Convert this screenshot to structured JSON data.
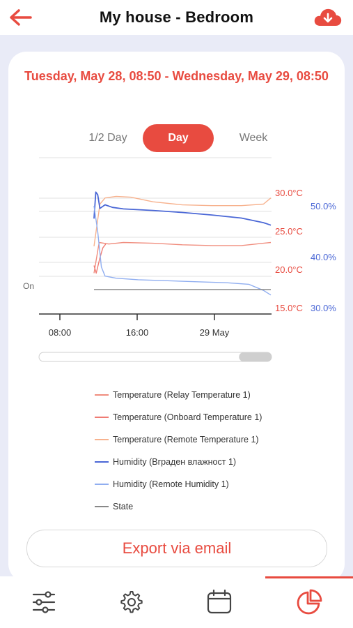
{
  "header": {
    "title": "My house - Bedroom"
  },
  "card": {
    "date_range": "Tuesday, May 28, 08:50 - Wednesday, May 29, 08:50"
  },
  "tabs": [
    {
      "label": "1/2 Day",
      "active": false
    },
    {
      "label": "Day",
      "active": true
    },
    {
      "label": "Week",
      "active": false
    }
  ],
  "chart_data": {
    "type": "line",
    "x_ticks": [
      "08:00",
      "16:00",
      "29 May"
    ],
    "left_axis_labels": [
      "On"
    ],
    "y_temp_ticks": [
      "30.0°C",
      "25.0°C",
      "20.0°C",
      "15.0°C"
    ],
    "y_humidity_ticks": [
      "50.0%",
      "40.0%",
      "30.0%"
    ],
    "y_temp_range": [
      15,
      30
    ],
    "y_humidity_range": [
      30,
      50
    ],
    "series": [
      {
        "name": "Temperature (Relay Temperature 1)",
        "axis": "temp",
        "color": "#f08d7e",
        "x": [
          0,
          0.7,
          2,
          4,
          8,
          12,
          16,
          20,
          24
        ],
        "y": [
          19.5,
          23.5,
          23.3,
          23.5,
          23.4,
          23.2,
          23.1,
          23.1,
          23.5
        ]
      },
      {
        "name": "Temperature (Onboard Temperature 1)",
        "axis": "temp",
        "color": "#ef7b73",
        "x": [
          0,
          0.3,
          0.8,
          1.2,
          1.6
        ],
        "y": [
          20.5,
          19.5,
          21.5,
          22.8,
          23.3
        ]
      },
      {
        "name": "Temperature (Remote Temperature 1)",
        "axis": "temp",
        "color": "#f7b28e",
        "x": [
          0,
          0.8,
          1.5,
          3,
          5,
          8,
          12,
          16,
          20,
          23,
          24
        ],
        "y": [
          23,
          28.5,
          29.3,
          29.5,
          29.4,
          28.8,
          28.4,
          28.3,
          28.3,
          28.5,
          29.3
        ]
      },
      {
        "name": "Humidity (Вграден влажност 1)",
        "axis": "humidity",
        "color": "#4a67d6",
        "x": [
          0,
          0.25,
          0.5,
          0.8,
          1.5,
          2.5,
          4,
          8,
          12,
          16,
          20,
          23,
          24
        ],
        "y": [
          47.5,
          52.7,
          52.2,
          49.5,
          50.2,
          49.7,
          49.4,
          49.1,
          48.7,
          48.2,
          47.6,
          46.7,
          46.2
        ]
      },
      {
        "name": "Humidity (Remote Humidity 1)",
        "axis": "humidity",
        "color": "#90aef0",
        "x": [
          0,
          0.5,
          1,
          1.5,
          3,
          6,
          10,
          14,
          18,
          21,
          23,
          24
        ],
        "y": [
          50,
          45,
          38,
          36.2,
          35.8,
          35.5,
          35.3,
          35.1,
          34.9,
          34.6,
          33.4,
          32.5
        ]
      },
      {
        "name": "State",
        "axis": "state",
        "color": "#888888",
        "x": [
          0,
          24
        ],
        "y": [
          0,
          0
        ]
      }
    ]
  },
  "legend": [
    {
      "label": "Temperature (Relay Temperature 1)",
      "color": "#f08d7e"
    },
    {
      "label": "Temperature (Onboard Temperature 1)",
      "color": "#ef7b73"
    },
    {
      "label": "Temperature (Remote Temperature 1)",
      "color": "#f7b28e"
    },
    {
      "label": "Humidity (Вграден влажност 1)",
      "color": "#4a67d6"
    },
    {
      "label": "Humidity (Remote Humidity 1)",
      "color": "#90aef0"
    },
    {
      "label": "State",
      "color": "#888888"
    }
  ],
  "export": {
    "label": "Export via email"
  },
  "bottom_nav": [
    {
      "icon": "sliders-icon",
      "active": false
    },
    {
      "icon": "gear-icon",
      "active": false
    },
    {
      "icon": "calendar-icon",
      "active": false
    },
    {
      "icon": "pie-chart-icon",
      "active": true
    }
  ],
  "colors": {
    "accent": "#e84b40",
    "temperature_axis": "#e84b40",
    "humidity_axis": "#4a67d6"
  },
  "scrollbar": {
    "visible_fraction": 0.14,
    "position": "end"
  }
}
